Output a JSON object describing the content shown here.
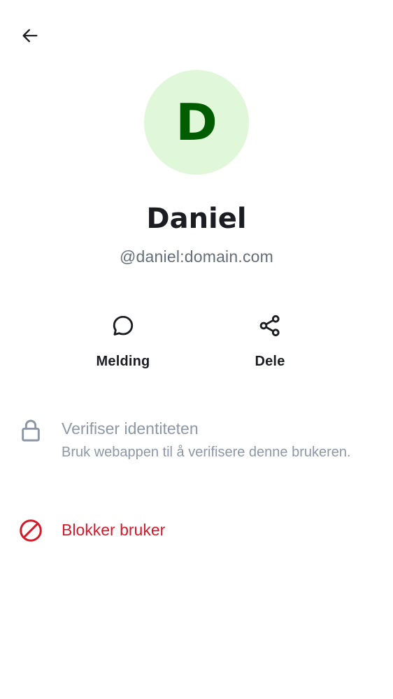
{
  "header": {
    "back_icon": "arrow-left-icon"
  },
  "profile": {
    "avatar_initial": "D",
    "avatar_bg": "#e0f8d9",
    "avatar_fg": "#005c00",
    "display_name": "Daniel",
    "user_id": "@daniel:domain.com"
  },
  "actions": {
    "message": {
      "label": "Melding",
      "icon": "chat-bubble-icon"
    },
    "share": {
      "label": "Dele",
      "icon": "share-icon"
    }
  },
  "verify": {
    "icon": "lock-icon",
    "title": "Verifiser identiteten",
    "subtitle": "Bruk webappen til å verifisere denne brukeren."
  },
  "block": {
    "icon": "block-icon",
    "title": "Blokker bruker",
    "color": "#d51928"
  }
}
